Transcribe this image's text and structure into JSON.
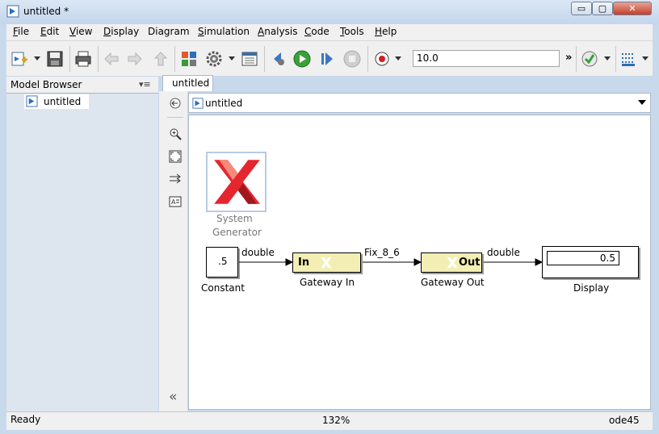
{
  "window": {
    "title": "untitled *",
    "min_glyph": "▭",
    "max_glyph": "▢",
    "close_glyph": "✕"
  },
  "menu": {
    "items": [
      {
        "label": "File",
        "ul": "F",
        "rest": "ile"
      },
      {
        "label": "Edit",
        "ul": "E",
        "rest": "dit"
      },
      {
        "label": "View",
        "ul": "V",
        "rest": "iew"
      },
      {
        "label": "Display",
        "ul": "D",
        "rest": "isplay"
      },
      {
        "label": "Diagram",
        "ul": "",
        "rest": "Diagram"
      },
      {
        "label": "Simulation",
        "ul": "S",
        "rest": "imulation"
      },
      {
        "label": "Analysis",
        "ul": "A",
        "rest": "nalysis"
      },
      {
        "label": "Code",
        "ul": "C",
        "rest": "ode"
      },
      {
        "label": "Tools",
        "ul": "T",
        "rest": "ools"
      },
      {
        "label": "Help",
        "ul": "H",
        "rest": "elp"
      }
    ]
  },
  "toolbar": {
    "stop_time": "10.0",
    "more": "»"
  },
  "browser": {
    "title": "Model Browser",
    "header_glyph": "▾≡",
    "tree_item": "untitled"
  },
  "editor": {
    "tab": "untitled",
    "address": "untitled",
    "collapse": "«"
  },
  "diagram": {
    "sysgen_label_1": "System",
    "sysgen_label_2": "Generator",
    "constant_value": ".5",
    "constant_label": "Constant",
    "gateway_in_text": "In",
    "gateway_in_label": "Gateway In",
    "gateway_out_text": "Out",
    "gateway_out_label": "Gateway Out",
    "display_value": "0.5",
    "display_label": "Display",
    "sig1": "double",
    "sig2": "Fix_8_6",
    "sig3": "double"
  },
  "status": {
    "left": "Ready",
    "zoom": "132%",
    "solver": "ode45"
  }
}
